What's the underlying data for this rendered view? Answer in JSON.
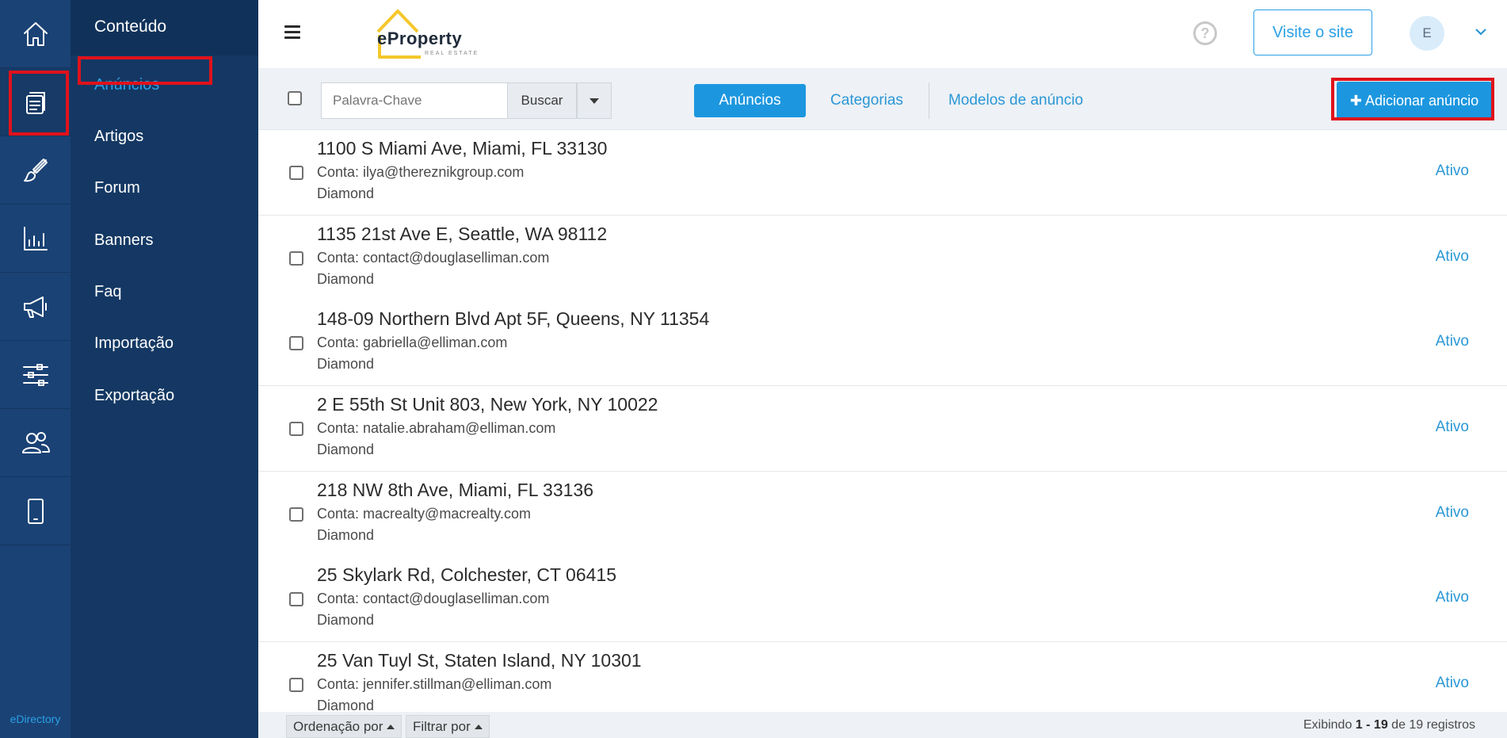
{
  "rail": {
    "items": [
      {
        "icon": "home-icon"
      },
      {
        "icon": "content-icon"
      },
      {
        "icon": "brush-icon"
      },
      {
        "icon": "chart-icon"
      },
      {
        "icon": "megaphone-icon"
      },
      {
        "icon": "sliders-icon"
      },
      {
        "icon": "users-icon"
      },
      {
        "icon": "mobile-icon"
      }
    ],
    "brand": "eDirectory"
  },
  "submenu": {
    "header": "Conteúdo",
    "items": [
      {
        "label": "Anúncios",
        "active": true
      },
      {
        "label": "Artigos"
      },
      {
        "label": "Forum"
      },
      {
        "label": "Banners"
      },
      {
        "label": "Faq"
      },
      {
        "label": "Importação"
      },
      {
        "label": "Exportação"
      }
    ]
  },
  "header": {
    "logo_text": "eProperty",
    "logo_sub": "REAL ESTATE",
    "help_glyph": "?",
    "visit_label": "Visite o site",
    "avatar_initial": "E"
  },
  "toolbar": {
    "search_placeholder": "Palavra-Chave",
    "search_button": "Buscar",
    "tabs": [
      "Anúncios",
      "Categorias",
      "Modelos de anúncio"
    ],
    "add_button": "✚ Adicionar anúncio"
  },
  "listings": [
    {
      "title": "1100 S Miami Ave, Miami, FL 33130",
      "account": "Conta: ilya@thereznikgroup.com",
      "level": "Diamond",
      "status": "Ativo"
    },
    {
      "title": "1135 21st Ave E, Seattle, WA 98112",
      "account": "Conta: contact@douglaselliman.com",
      "level": "Diamond",
      "status": "Ativo"
    },
    {
      "title": "148-09 Northern Blvd Apt 5F, Queens, NY 11354",
      "account": "Conta: gabriella@elliman.com",
      "level": "Diamond",
      "status": "Ativo"
    },
    {
      "title": "2 E 55th St Unit 803, New York, NY 10022",
      "account": "Conta: natalie.abraham@elliman.com",
      "level": "Diamond",
      "status": "Ativo"
    },
    {
      "title": "218 NW 8th Ave, Miami, FL 33136",
      "account": "Conta: macrealty@macrealty.com",
      "level": "Diamond",
      "status": "Ativo"
    },
    {
      "title": "25 Skylark Rd, Colchester, CT 06415",
      "account": "Conta: contact@douglaselliman.com",
      "level": "Diamond",
      "status": "Ativo"
    },
    {
      "title": "25 Van Tuyl St, Staten Island, NY 10301",
      "account": "Conta: jennifer.stillman@elliman.com",
      "level": "Diamond",
      "status": "Ativo"
    }
  ],
  "footer": {
    "sort_label": "Ordenação por",
    "filter_label": "Filtrar por",
    "count_prefix": "Exibindo ",
    "count_range": "1 - 19",
    "count_suffix": " de 19 registros"
  },
  "colors": {
    "rail_bg": "#1a4275",
    "submenu_bg": "#143863",
    "accent": "#1c97df",
    "highlight": "#e0121b"
  }
}
